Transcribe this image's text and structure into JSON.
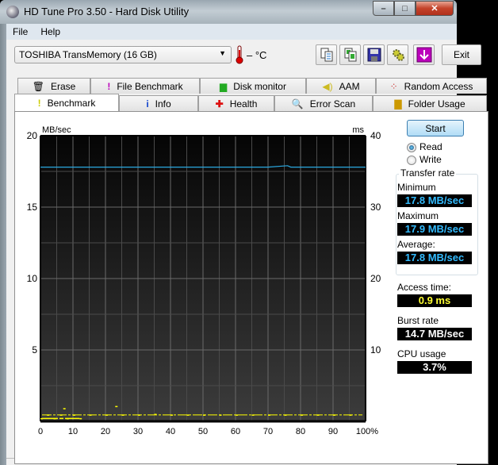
{
  "window": {
    "title": "HD Tune Pro 3.50 - Hard Disk Utility",
    "controls": {
      "minimize": "–",
      "maximize": "□",
      "close": "✕"
    }
  },
  "menu": [
    "File",
    "Help"
  ],
  "toolbar": {
    "drive": "TOSHIBA TransMemory (16 GB)",
    "temperature": "– °C",
    "icons": [
      "copy-text-icon",
      "copy-screenshot-icon",
      "save-icon",
      "options-icon",
      "download-icon"
    ],
    "exit_label": "Exit"
  },
  "tabs_row1": [
    {
      "label": "Erase",
      "icon": "trash-icon"
    },
    {
      "label": "File Benchmark",
      "icon": "file-benchmark-icon"
    },
    {
      "label": "Disk monitor",
      "icon": "disk-monitor-icon"
    },
    {
      "label": "AAM",
      "icon": "speaker-icon"
    },
    {
      "label": "Random Access",
      "icon": "random-access-icon"
    }
  ],
  "tabs_row2": [
    {
      "label": "Benchmark",
      "icon": "benchmark-icon",
      "active": true
    },
    {
      "label": "Info",
      "icon": "info-icon"
    },
    {
      "label": "Health",
      "icon": "health-icon"
    },
    {
      "label": "Error Scan",
      "icon": "magnifier-icon"
    },
    {
      "label": "Folder Usage",
      "icon": "folder-icon"
    }
  ],
  "benchmark": {
    "start_label": "Start",
    "mode_options": [
      {
        "label": "Read",
        "selected": true
      },
      {
        "label": "Write",
        "selected": false
      }
    ],
    "transfer_rate_title": "Transfer rate",
    "minimum_label": "Minimum",
    "minimum_value": "17.8 MB/sec",
    "maximum_label": "Maximum",
    "maximum_value": "17.9 MB/sec",
    "average_label": "Average:",
    "average_value": "17.8 MB/sec",
    "access_time_label": "Access time:",
    "access_time_value": "0.9 ms",
    "burst_rate_label": "Burst rate",
    "burst_rate_value": "14.7 MB/sec",
    "cpu_usage_label": "CPU usage",
    "cpu_usage_value": "3.7%",
    "colors": {
      "transfer": "#2aa8e0",
      "access": "#ffff00",
      "value_blue": "#33bbff",
      "value_yellow": "#ffff33",
      "value_white": "#ffffff"
    }
  },
  "chart_data": {
    "type": "line",
    "title": "",
    "ylabel": "MB/sec",
    "y2label": "ms",
    "xlabel": "",
    "x_ticks": [
      "0",
      "10",
      "20",
      "30",
      "40",
      "50",
      "60",
      "70",
      "80",
      "90",
      "100%"
    ],
    "y_ticks": [
      "5",
      "10",
      "15",
      "20"
    ],
    "y2_ticks": [
      "10",
      "20",
      "30",
      "40"
    ],
    "xlim": [
      0,
      100
    ],
    "ylim": [
      0,
      20
    ],
    "y2lim": [
      0,
      40
    ],
    "grid": true,
    "series": [
      {
        "name": "Transfer rate (MB/sec)",
        "axis": "left",
        "color": "#2aa8e0",
        "x": [
          0,
          10,
          20,
          30,
          40,
          50,
          60,
          70,
          76,
          77,
          80,
          90,
          100
        ],
        "values": [
          17.8,
          17.8,
          17.8,
          17.8,
          17.8,
          17.8,
          17.8,
          17.8,
          17.9,
          17.8,
          17.8,
          17.8,
          17.8
        ]
      },
      {
        "name": "Access time (ms)",
        "axis": "right",
        "color": "#ffff00",
        "style": "scatter",
        "x": [
          0,
          2,
          4,
          6,
          7,
          8,
          10,
          12,
          15,
          20,
          23,
          25,
          30,
          35,
          40,
          45,
          50,
          55,
          60,
          65,
          70,
          75,
          80,
          85,
          90,
          95
        ],
        "values": [
          0.4,
          0.9,
          0.4,
          0.9,
          1.8,
          0.4,
          0.9,
          0.4,
          0.9,
          0.9,
          2.1,
          0.9,
          0.9,
          1.0,
          0.9,
          0.9,
          0.9,
          0.9,
          0.9,
          0.9,
          0.9,
          0.9,
          0.9,
          0.9,
          0.9,
          0.9
        ]
      }
    ]
  }
}
